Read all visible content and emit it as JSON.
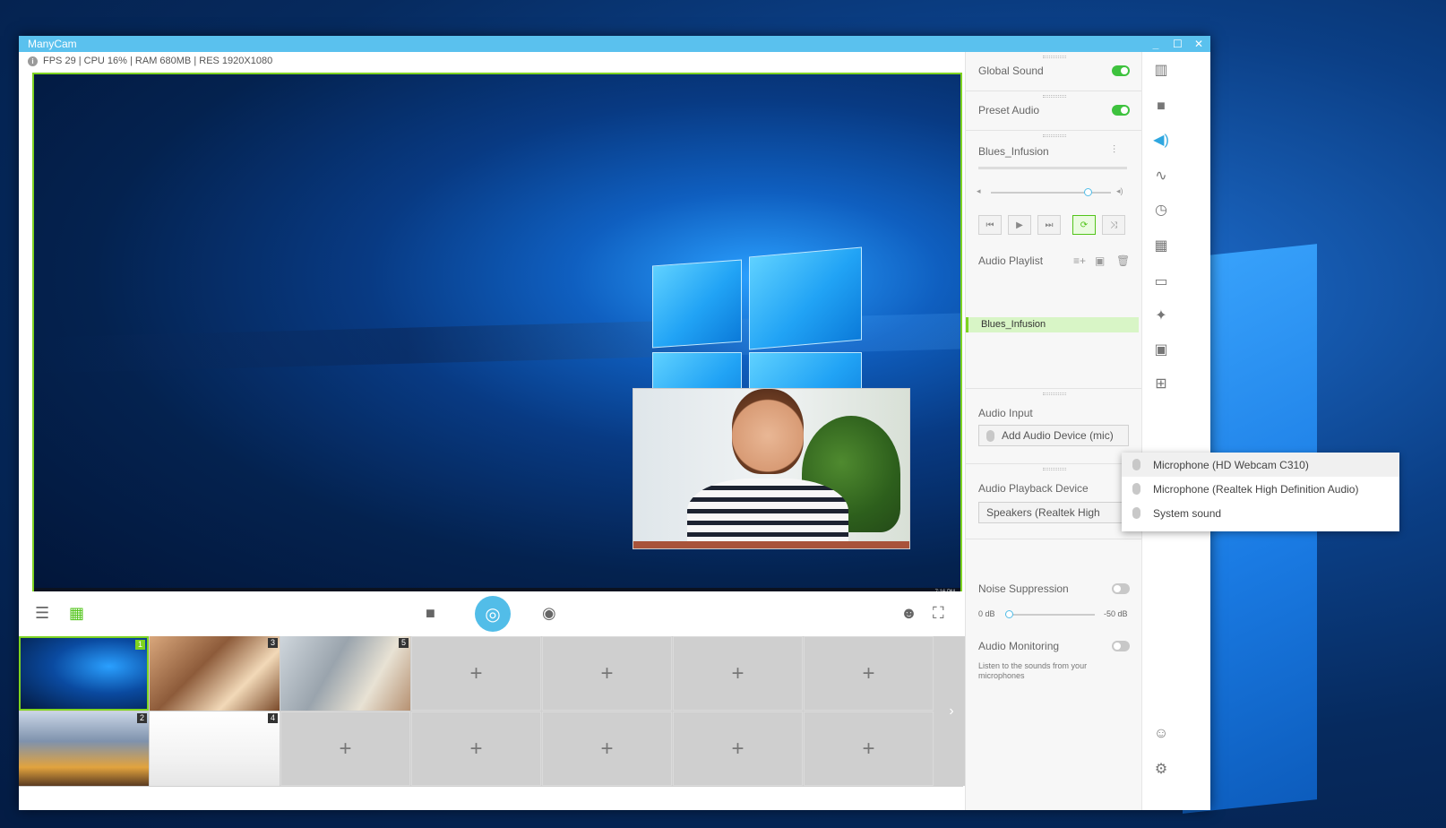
{
  "window": {
    "title": "ManyCam",
    "controls": {
      "minimize": "_",
      "maximize": "☐",
      "close": "✕"
    }
  },
  "stats": "FPS 29 | CPU 16% | RAM 680MB | RES 1920X1080",
  "taskbar": {
    "time": "7:16 PM",
    "date": "2018-11-29"
  },
  "toolbar": {
    "broadcast_icon": "broadcast-icon"
  },
  "presets": [
    {
      "num": "1"
    },
    {
      "num": "3"
    },
    {
      "num": "5"
    },
    {
      "num": "2"
    },
    {
      "num": "4"
    }
  ],
  "add_symbol": "+",
  "arrow": "›",
  "panel": {
    "global_sound": {
      "label": "Global Sound",
      "on": true
    },
    "preset_audio": {
      "label": "Preset Audio",
      "on": true
    },
    "track_name": "Blues_Infusion",
    "playlist_label": "Audio Playlist",
    "playlist_items": [
      "Blues_Infusion"
    ],
    "audio_input_label": "Audio Input",
    "add_device_label": "Add Audio Device (mic)",
    "playback_label": "Audio Playback Device",
    "playback_value": "Speakers (Realtek High",
    "noise_label": "Noise Suppression",
    "noise_min": "0 dB",
    "noise_max": "-50 dB",
    "monitor_label": "Audio Monitoring",
    "monitor_hint": "Listen to the sounds from your microphones"
  },
  "dropdown": {
    "items": [
      "Microphone (HD Webcam C310)",
      "Microphone (Realtek High Definition Audio)",
      "System sound"
    ]
  }
}
